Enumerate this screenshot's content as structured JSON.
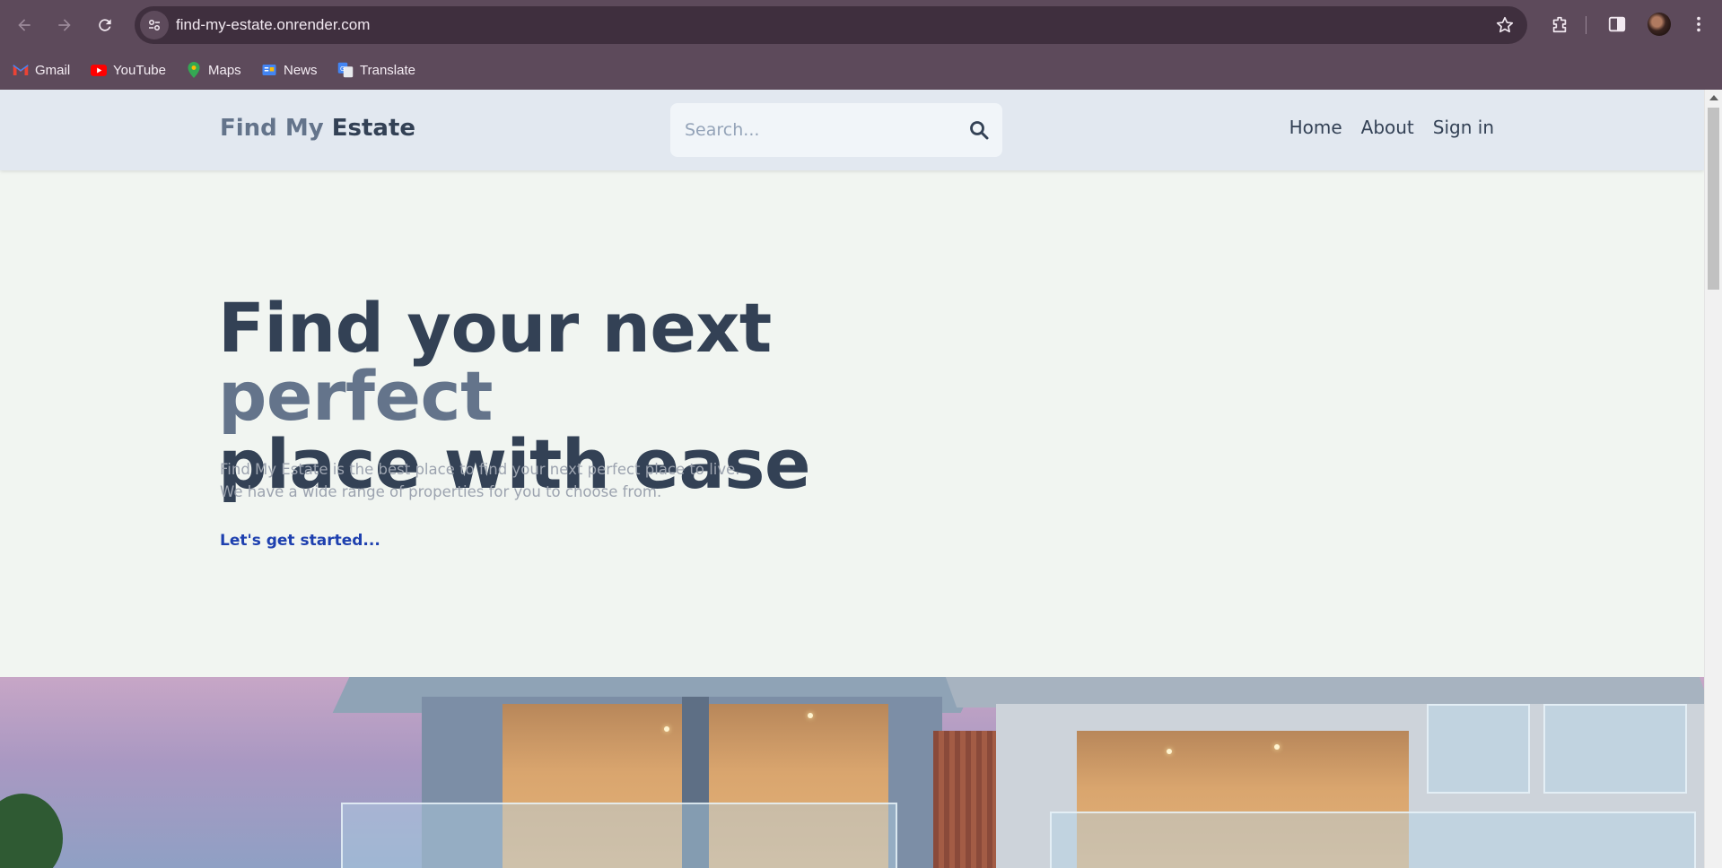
{
  "browser": {
    "url": "find-my-estate.onrender.com",
    "bookmarks": [
      {
        "label": "Gmail",
        "icon": "gmail-icon"
      },
      {
        "label": "YouTube",
        "icon": "youtube-icon"
      },
      {
        "label": "Maps",
        "icon": "maps-icon"
      },
      {
        "label": "News",
        "icon": "news-icon"
      },
      {
        "label": "Translate",
        "icon": "translate-icon"
      }
    ]
  },
  "header": {
    "brand_part1": "Find My",
    "brand_part2": "Estate",
    "search_placeholder": "Search...",
    "nav": {
      "home": "Home",
      "about": "About",
      "signin": "Sign in"
    }
  },
  "hero": {
    "title_part1": "Find your next",
    "title_accent": "perfect",
    "title_part2": "place with ease",
    "desc_line1": "Find My Estate is the best place to find your next perfect place to live.",
    "desc_line2": "We have a wide range of properties for you to choose from.",
    "cta": "Let's get started..."
  },
  "colors": {
    "chrome": "#5d4a5b",
    "header_bg": "#e2e8f0",
    "page_bg": "#f1f5f1",
    "text_dark": "#334155",
    "text_muted": "#64748b",
    "cta": "#1e40af"
  }
}
